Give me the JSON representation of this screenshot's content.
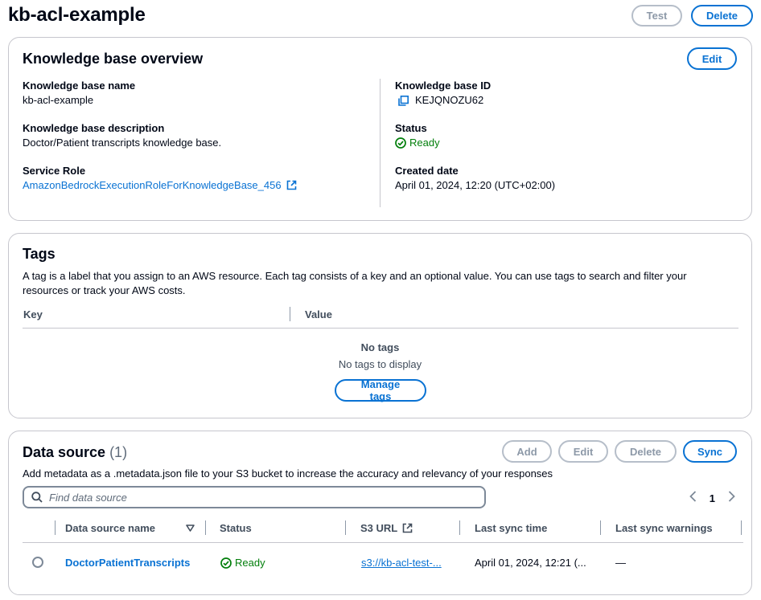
{
  "page": {
    "title": "kb-acl-example",
    "test_label": "Test",
    "delete_label": "Delete"
  },
  "overview": {
    "title": "Knowledge base overview",
    "edit_label": "Edit",
    "kb_name_label": "Knowledge base name",
    "kb_name": "kb-acl-example",
    "kb_desc_label": "Knowledge base description",
    "kb_desc": "Doctor/Patient transcripts knowledge base.",
    "role_label": "Service Role",
    "role": "AmazonBedrockExecutionRoleForKnowledgeBase_456",
    "kb_id_label": "Knowledge base ID",
    "kb_id": "KEJQNOZU62",
    "status_label": "Status",
    "status": "Ready",
    "created_label": "Created date",
    "created": "April 01, 2024, 12:20 (UTC+02:00)"
  },
  "tags": {
    "title": "Tags",
    "description": "A tag is a label that you assign to an AWS resource. Each tag consists of a key and an optional value. You can use tags to search and filter your resources or track your AWS costs.",
    "col_key": "Key",
    "col_value": "Value",
    "empty_title": "No tags",
    "empty_text": "No tags to display",
    "manage_label": "Manage tags"
  },
  "datasource": {
    "title": "Data source",
    "count": "(1)",
    "add_label": "Add",
    "edit_label": "Edit",
    "delete_label": "Delete",
    "sync_label": "Sync",
    "description": "Add metadata as a .metadata.json file to your S3 bucket to increase the accuracy and relevancy of your responses",
    "search_placeholder": "Find data source",
    "page_number": "1",
    "columns": {
      "name": "Data source name",
      "status": "Status",
      "s3": "S3 URL",
      "last_sync": "Last sync time",
      "warnings": "Last sync warnings"
    },
    "rows": [
      {
        "name": "DoctorPatientTranscripts",
        "status": "Ready",
        "s3": "s3://kb-acl-test-...",
        "last_sync": "April 01, 2024, 12:21 (...",
        "warnings": "—"
      }
    ]
  },
  "colors": {
    "link": "#0972d3",
    "success": "#037f0c",
    "border": "#c6c6cd"
  }
}
